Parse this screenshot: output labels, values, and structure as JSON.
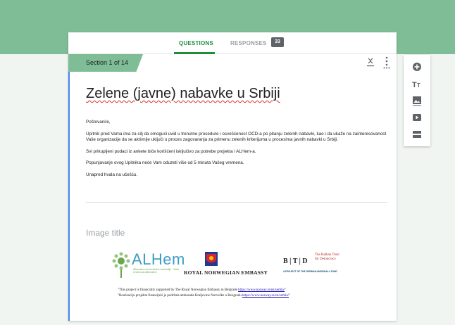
{
  "tabs": {
    "questions_label": "QUESTIONS",
    "responses_label": "RESPONSES",
    "responses_count": "33"
  },
  "section": {
    "label": "Section 1 of 14"
  },
  "form": {
    "title": "Zelene (javne) nabavke u Srbiji",
    "description": [
      "Poštovani/e,",
      "Upitnik pred Vama ima za cilj da omogući uvid u trenutne procedure i osvešćenost OCD-a po pitanju zelenih nabavki, kao i da ukaže na zainteresovanost Vaše organizacije da se aktivnije uključi u proces zagovaranja za primenu zelenih kriterijuma u procesima javnih nabavki u Srbiji.",
      "Svi prikupljeni podaci iz ankete biće korišćeni isključivo za potrebe projekta i ALHem-a.",
      "Popunjavanje ovog Upitnika neće Vam oduzeti više od 5 minuta Vašeg vremena.",
      "Unapred hvala na učešću."
    ],
    "image_title_placeholder": "Image title"
  },
  "image": {
    "alhem_name": "ALHem",
    "alhem_tagline": "Alternativa za bezbedne hemikalije · Safer Chemicals Alternative",
    "rne_name": "ROYAL NORWEGIAN EMBASSY",
    "btd_letters": "B | T | D",
    "btd_name_1": "The Balkan Trust",
    "btd_name_2": "for Democracy",
    "btd_tagline": "A PROJECT OF THE GERMAN MARSHALL FUND",
    "caption_en_text": "\"This project is financially supported by The Royal Norwegian Embassy in Belgrade ",
    "caption_en_link": "https://www.norway.rs/en/serbia/",
    "caption_sr_text": "\"Realizaciju projekta finansijski je podržala ambasada Kraljevine Norveške u Beogradu ",
    "caption_sr_link": "https://www.norway.rs/en/serbia/",
    "caption_end": "\""
  },
  "toolbar": {
    "items": [
      "add-question-icon",
      "add-title-icon",
      "add-image-icon",
      "add-video-icon",
      "add-section-icon"
    ]
  },
  "colors": {
    "header_green": "#7ebd95",
    "accent_green": "#1e8e3e",
    "focus_blue": "#4285f4",
    "background": "#f0f5f1"
  }
}
